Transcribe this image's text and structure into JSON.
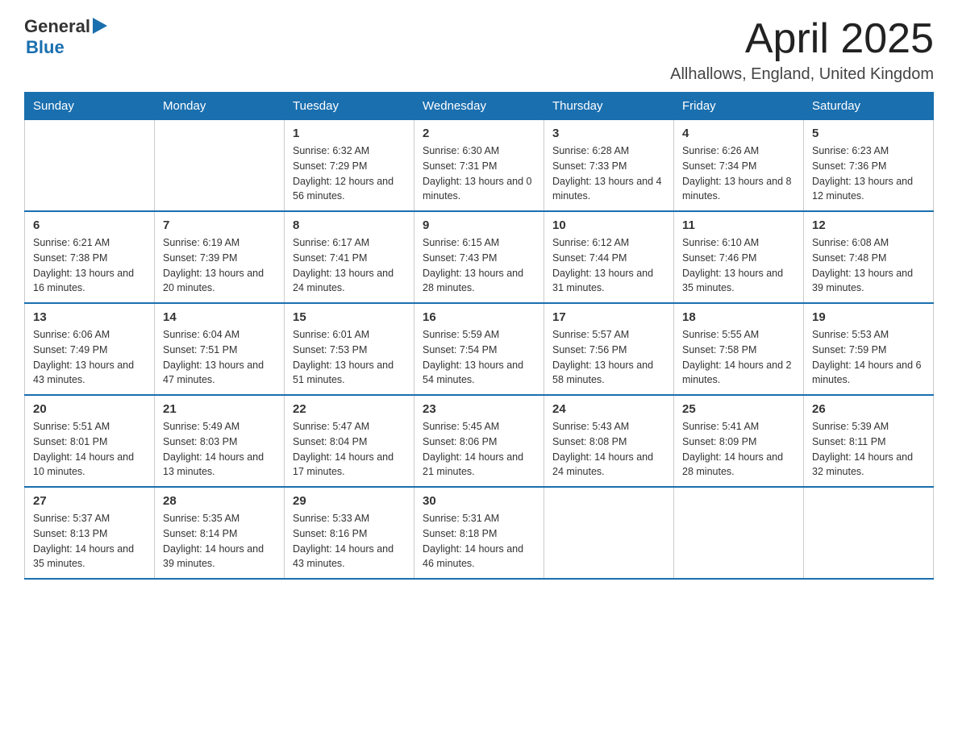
{
  "header": {
    "logo_text": "General",
    "logo_blue": "Blue",
    "month_title": "April 2025",
    "subtitle": "Allhallows, England, United Kingdom"
  },
  "columns": [
    "Sunday",
    "Monday",
    "Tuesday",
    "Wednesday",
    "Thursday",
    "Friday",
    "Saturday"
  ],
  "weeks": [
    [
      {
        "day": "",
        "sunrise": "",
        "sunset": "",
        "daylight": ""
      },
      {
        "day": "",
        "sunrise": "",
        "sunset": "",
        "daylight": ""
      },
      {
        "day": "1",
        "sunrise": "Sunrise: 6:32 AM",
        "sunset": "Sunset: 7:29 PM",
        "daylight": "Daylight: 12 hours and 56 minutes."
      },
      {
        "day": "2",
        "sunrise": "Sunrise: 6:30 AM",
        "sunset": "Sunset: 7:31 PM",
        "daylight": "Daylight: 13 hours and 0 minutes."
      },
      {
        "day": "3",
        "sunrise": "Sunrise: 6:28 AM",
        "sunset": "Sunset: 7:33 PM",
        "daylight": "Daylight: 13 hours and 4 minutes."
      },
      {
        "day": "4",
        "sunrise": "Sunrise: 6:26 AM",
        "sunset": "Sunset: 7:34 PM",
        "daylight": "Daylight: 13 hours and 8 minutes."
      },
      {
        "day": "5",
        "sunrise": "Sunrise: 6:23 AM",
        "sunset": "Sunset: 7:36 PM",
        "daylight": "Daylight: 13 hours and 12 minutes."
      }
    ],
    [
      {
        "day": "6",
        "sunrise": "Sunrise: 6:21 AM",
        "sunset": "Sunset: 7:38 PM",
        "daylight": "Daylight: 13 hours and 16 minutes."
      },
      {
        "day": "7",
        "sunrise": "Sunrise: 6:19 AM",
        "sunset": "Sunset: 7:39 PM",
        "daylight": "Daylight: 13 hours and 20 minutes."
      },
      {
        "day": "8",
        "sunrise": "Sunrise: 6:17 AM",
        "sunset": "Sunset: 7:41 PM",
        "daylight": "Daylight: 13 hours and 24 minutes."
      },
      {
        "day": "9",
        "sunrise": "Sunrise: 6:15 AM",
        "sunset": "Sunset: 7:43 PM",
        "daylight": "Daylight: 13 hours and 28 minutes."
      },
      {
        "day": "10",
        "sunrise": "Sunrise: 6:12 AM",
        "sunset": "Sunset: 7:44 PM",
        "daylight": "Daylight: 13 hours and 31 minutes."
      },
      {
        "day": "11",
        "sunrise": "Sunrise: 6:10 AM",
        "sunset": "Sunset: 7:46 PM",
        "daylight": "Daylight: 13 hours and 35 minutes."
      },
      {
        "day": "12",
        "sunrise": "Sunrise: 6:08 AM",
        "sunset": "Sunset: 7:48 PM",
        "daylight": "Daylight: 13 hours and 39 minutes."
      }
    ],
    [
      {
        "day": "13",
        "sunrise": "Sunrise: 6:06 AM",
        "sunset": "Sunset: 7:49 PM",
        "daylight": "Daylight: 13 hours and 43 minutes."
      },
      {
        "day": "14",
        "sunrise": "Sunrise: 6:04 AM",
        "sunset": "Sunset: 7:51 PM",
        "daylight": "Daylight: 13 hours and 47 minutes."
      },
      {
        "day": "15",
        "sunrise": "Sunrise: 6:01 AM",
        "sunset": "Sunset: 7:53 PM",
        "daylight": "Daylight: 13 hours and 51 minutes."
      },
      {
        "day": "16",
        "sunrise": "Sunrise: 5:59 AM",
        "sunset": "Sunset: 7:54 PM",
        "daylight": "Daylight: 13 hours and 54 minutes."
      },
      {
        "day": "17",
        "sunrise": "Sunrise: 5:57 AM",
        "sunset": "Sunset: 7:56 PM",
        "daylight": "Daylight: 13 hours and 58 minutes."
      },
      {
        "day": "18",
        "sunrise": "Sunrise: 5:55 AM",
        "sunset": "Sunset: 7:58 PM",
        "daylight": "Daylight: 14 hours and 2 minutes."
      },
      {
        "day": "19",
        "sunrise": "Sunrise: 5:53 AM",
        "sunset": "Sunset: 7:59 PM",
        "daylight": "Daylight: 14 hours and 6 minutes."
      }
    ],
    [
      {
        "day": "20",
        "sunrise": "Sunrise: 5:51 AM",
        "sunset": "Sunset: 8:01 PM",
        "daylight": "Daylight: 14 hours and 10 minutes."
      },
      {
        "day": "21",
        "sunrise": "Sunrise: 5:49 AM",
        "sunset": "Sunset: 8:03 PM",
        "daylight": "Daylight: 14 hours and 13 minutes."
      },
      {
        "day": "22",
        "sunrise": "Sunrise: 5:47 AM",
        "sunset": "Sunset: 8:04 PM",
        "daylight": "Daylight: 14 hours and 17 minutes."
      },
      {
        "day": "23",
        "sunrise": "Sunrise: 5:45 AM",
        "sunset": "Sunset: 8:06 PM",
        "daylight": "Daylight: 14 hours and 21 minutes."
      },
      {
        "day": "24",
        "sunrise": "Sunrise: 5:43 AM",
        "sunset": "Sunset: 8:08 PM",
        "daylight": "Daylight: 14 hours and 24 minutes."
      },
      {
        "day": "25",
        "sunrise": "Sunrise: 5:41 AM",
        "sunset": "Sunset: 8:09 PM",
        "daylight": "Daylight: 14 hours and 28 minutes."
      },
      {
        "day": "26",
        "sunrise": "Sunrise: 5:39 AM",
        "sunset": "Sunset: 8:11 PM",
        "daylight": "Daylight: 14 hours and 32 minutes."
      }
    ],
    [
      {
        "day": "27",
        "sunrise": "Sunrise: 5:37 AM",
        "sunset": "Sunset: 8:13 PM",
        "daylight": "Daylight: 14 hours and 35 minutes."
      },
      {
        "day": "28",
        "sunrise": "Sunrise: 5:35 AM",
        "sunset": "Sunset: 8:14 PM",
        "daylight": "Daylight: 14 hours and 39 minutes."
      },
      {
        "day": "29",
        "sunrise": "Sunrise: 5:33 AM",
        "sunset": "Sunset: 8:16 PM",
        "daylight": "Daylight: 14 hours and 43 minutes."
      },
      {
        "day": "30",
        "sunrise": "Sunrise: 5:31 AM",
        "sunset": "Sunset: 8:18 PM",
        "daylight": "Daylight: 14 hours and 46 minutes."
      },
      {
        "day": "",
        "sunrise": "",
        "sunset": "",
        "daylight": ""
      },
      {
        "day": "",
        "sunrise": "",
        "sunset": "",
        "daylight": ""
      },
      {
        "day": "",
        "sunrise": "",
        "sunset": "",
        "daylight": ""
      }
    ]
  ]
}
